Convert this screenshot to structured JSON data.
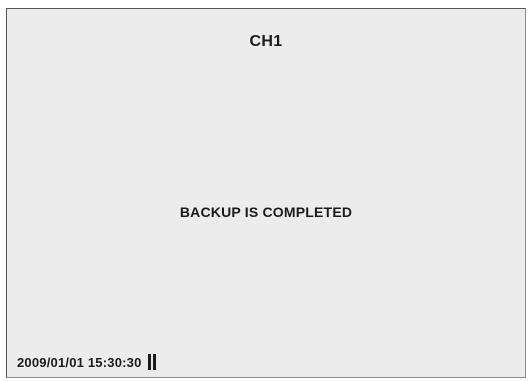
{
  "screen": {
    "channel_title": "CH1",
    "status_message": "BACKUP IS COMPLETED",
    "timestamp": "2009/01/01 15:30:30"
  },
  "icons": {
    "record_indicator": "double-bar-indicator-icon"
  },
  "colors": {
    "background": "#ececec",
    "text": "#1a1a1a",
    "border": "#555555"
  }
}
